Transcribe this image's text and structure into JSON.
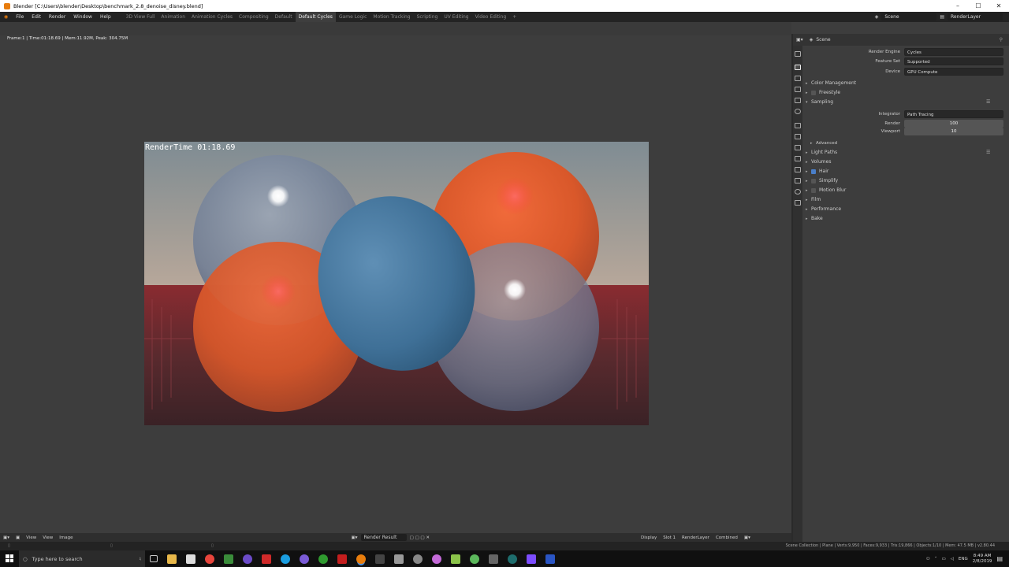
{
  "window": {
    "title": "Blender [C:\\Users\\blender\\Desktop\\benchmark_2.8_denoise_disney.blend]"
  },
  "menu": [
    "File",
    "Edit",
    "Render",
    "Window",
    "Help"
  ],
  "workspaces": [
    "3D View Full",
    "Animation",
    "Animation Cycles",
    "Compositing",
    "Default",
    "Default Cycles",
    "Game Logic",
    "Motion Tracking",
    "Scripting",
    "UV Editing",
    "Video Editing"
  ],
  "scene": {
    "label": "Scene",
    "layer": "RenderLayer"
  },
  "viewer": {
    "frame_info": "Frame:1 | Time:01:18.69 | Mem:11.92M, Peak: 304.75M",
    "render_time": "RenderTime 01:18.69"
  },
  "viewer_footer": {
    "view1": "View",
    "view2": "View",
    "image": "Image",
    "image_name": "Render Result",
    "display": "Display",
    "slot": "Slot 1",
    "layer": "RenderLayer",
    "pass": "Combined"
  },
  "properties": {
    "header": "Scene",
    "render_engine": {
      "label": "Render Engine",
      "value": "Cycles"
    },
    "feature_set": {
      "label": "Feature Set",
      "value": "Supported"
    },
    "device": {
      "label": "Device",
      "value": "GPU Compute"
    },
    "color_management": "Color Management",
    "freestyle": "Freestyle",
    "sampling": "Sampling",
    "integrator": {
      "label": "Integrator",
      "value": "Path Tracing"
    },
    "render_samples": {
      "label": "Render",
      "value": "100"
    },
    "viewport_samples": {
      "label": "Viewport",
      "value": "10"
    },
    "advanced": "Advanced",
    "light_paths": "Light Paths",
    "volumes": "Volumes",
    "hair": "Hair",
    "simplify": "Simplify",
    "motion_blur": "Motion Blur",
    "film": "Film",
    "performance": "Performance",
    "bake": "Bake"
  },
  "statusbar": {
    "info": "Scene Collection | Plane | Verts:9,950 | Faces:9,933 | Tris:19,866 | Objects:1/10 | Mem: 47.5 MB | v2.80.44"
  },
  "taskbar": {
    "search_placeholder": "Type here to search",
    "lang": "ENG",
    "time": "8:49 AM",
    "date": "2/8/2019"
  }
}
